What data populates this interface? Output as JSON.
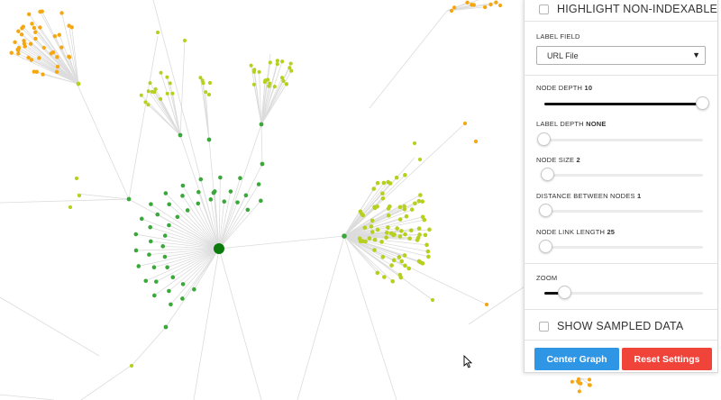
{
  "settings": {
    "highlight_label": "HIGHLIGHT NON-INDEXABLE",
    "label_field": {
      "label": "LABEL FIELD",
      "value": "URL File"
    },
    "node_depth": {
      "label": "NODE DEPTH",
      "value": "10",
      "level": 1.0
    },
    "label_depth": {
      "label": "LABEL DEPTH",
      "value": "NONE",
      "level": 0.0
    },
    "node_size": {
      "label": "NODE SIZE",
      "value": "2",
      "level": 0.0
    },
    "distance": {
      "label": "DISTANCE BETWEEN NODES",
      "value": "1",
      "level": 0.0
    },
    "link_length": {
      "label": "NODE LINK LENGTH",
      "value": "25",
      "level": 0.0
    },
    "zoom": {
      "label": "ZOOM",
      "level": 0.13
    },
    "sampled_label": "SHOW SAMPLED DATA",
    "center_button": "Center Graph",
    "reset_button": "Reset Settings"
  },
  "colors": {
    "node_dark_green": "#0a7a0a",
    "node_green": "#3aa83a",
    "node_yellow_green": "#b7cf1d",
    "node_orange": "#f5a712",
    "link": "#dcdcdc",
    "button_blue": "#2f95e5",
    "button_red": "#f0433a"
  }
}
